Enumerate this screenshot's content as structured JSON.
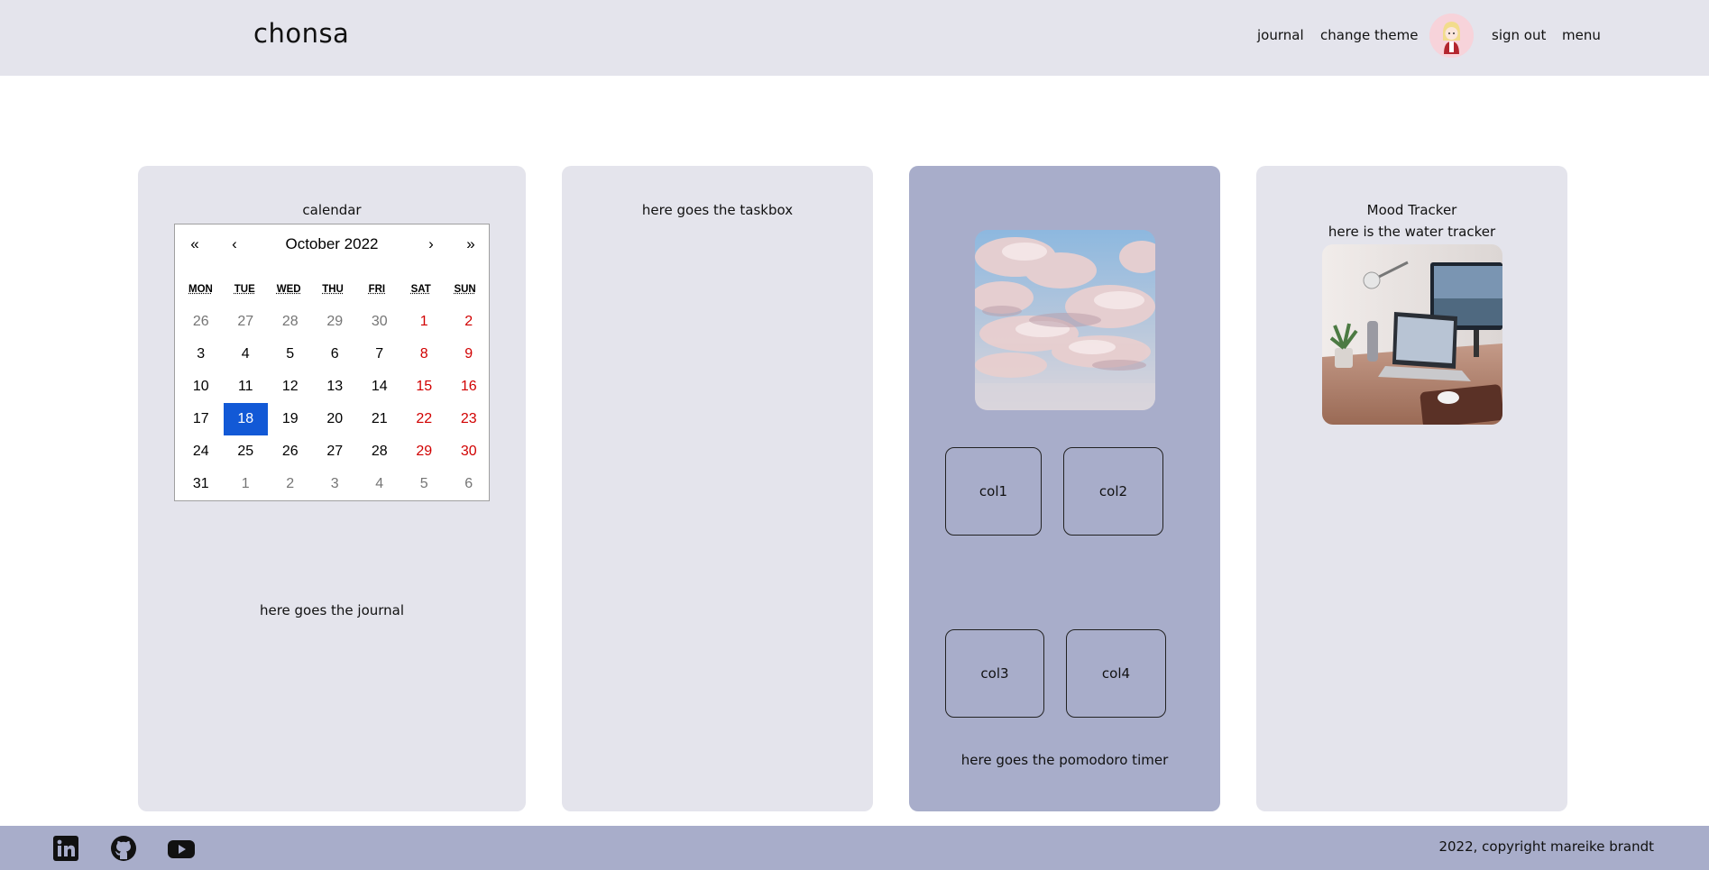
{
  "header": {
    "brand": "chonsa",
    "nav": {
      "journal": "journal",
      "change_theme": "change theme",
      "sign_out": "sign out",
      "menu": "menu"
    }
  },
  "calendar_card": {
    "title": "calendar",
    "journal_placeholder": "here goes the journal",
    "calendar": {
      "prev_year": "«",
      "prev_month": "‹",
      "label": "October 2022",
      "next_month": "›",
      "next_year": "»",
      "weekdays": [
        "MON",
        "TUE",
        "WED",
        "THU",
        "FRI",
        "SAT",
        "SUN"
      ],
      "weeks": [
        [
          "26",
          "27",
          "28",
          "29",
          "30",
          "1",
          "2"
        ],
        [
          "3",
          "4",
          "5",
          "6",
          "7",
          "8",
          "9"
        ],
        [
          "10",
          "11",
          "12",
          "13",
          "14",
          "15",
          "16"
        ],
        [
          "17",
          "18",
          "19",
          "20",
          "21",
          "22",
          "23"
        ],
        [
          "24",
          "25",
          "26",
          "27",
          "28",
          "29",
          "30"
        ],
        [
          "31",
          "1",
          "2",
          "3",
          "4",
          "5",
          "6"
        ]
      ],
      "selected": "18"
    }
  },
  "task_card": {
    "title": "here goes the taskbox"
  },
  "pomodoro_card": {
    "col1": "col1",
    "col2": "col2",
    "col3": "col3",
    "col4": "col4",
    "footer_text": "here goes the pomodoro timer"
  },
  "mood_card": {
    "title": "Mood Tracker",
    "subtitle": "here is the water tracker"
  },
  "footer": {
    "copyright": "2022, copyright mareike brandt",
    "icons": [
      "linkedin-icon",
      "github-icon",
      "youtube-icon"
    ]
  },
  "colors": {
    "header_bg": "#e4e4ec",
    "card_bg": "#e4e4ec",
    "accent_card_bg": "#a8adca",
    "footer_bg": "#a8adca",
    "calendar_selected": "#1259d6",
    "calendar_weekend": "#d10000"
  }
}
